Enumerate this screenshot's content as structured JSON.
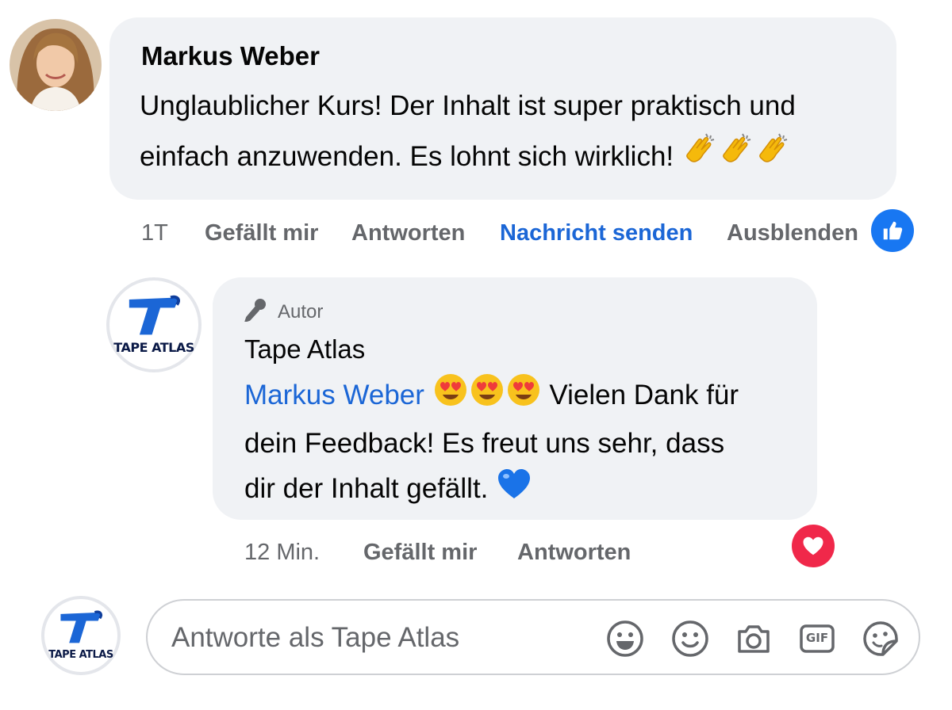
{
  "comment": {
    "author": "Markus Weber",
    "text_line1": "Unglaublicher Kurs! Der Inhalt ist super praktisch und",
    "text_line2": "einfach anzuwenden. Es lohnt sich wirklich!",
    "emojis": [
      "clapping-hands",
      "clapping-hands",
      "clapping-hands"
    ],
    "actions": {
      "time": "1T",
      "like": "Gefällt mir",
      "reply": "Antworten",
      "message": "Nachricht senden",
      "hide": "Ausblenden"
    },
    "reaction": "like-reaction"
  },
  "reply": {
    "badge": "Autor",
    "author": "Tape Atlas",
    "mention": "Markus Weber",
    "mention_emojis": [
      "heart-eyes",
      "heart-eyes",
      "heart-eyes"
    ],
    "text_line1_rest": "Vielen Dank für",
    "text_line2": "dein Feedback! Es freut uns sehr, dass",
    "text_line3": "dir der Inhalt gefällt.",
    "end_emoji": "blue-heart",
    "actions": {
      "time": "12 Min.",
      "like": "Gefällt mir",
      "reply": "Antworten"
    },
    "reaction": "love-reaction"
  },
  "brand": {
    "wordmark": "TAPE ATLAS"
  },
  "composer": {
    "placeholder": "Antworte als Tape Atlas",
    "tools": [
      "emoji-icon",
      "smiley-icon",
      "camera-icon",
      "gif-icon",
      "sticker-icon"
    ],
    "gif_label": "GIF"
  },
  "colors": {
    "bubble": "#f0f2f5",
    "link": "#1b66d6",
    "muted": "#65676b",
    "like": "#1877f2",
    "love": "#f0284a"
  }
}
